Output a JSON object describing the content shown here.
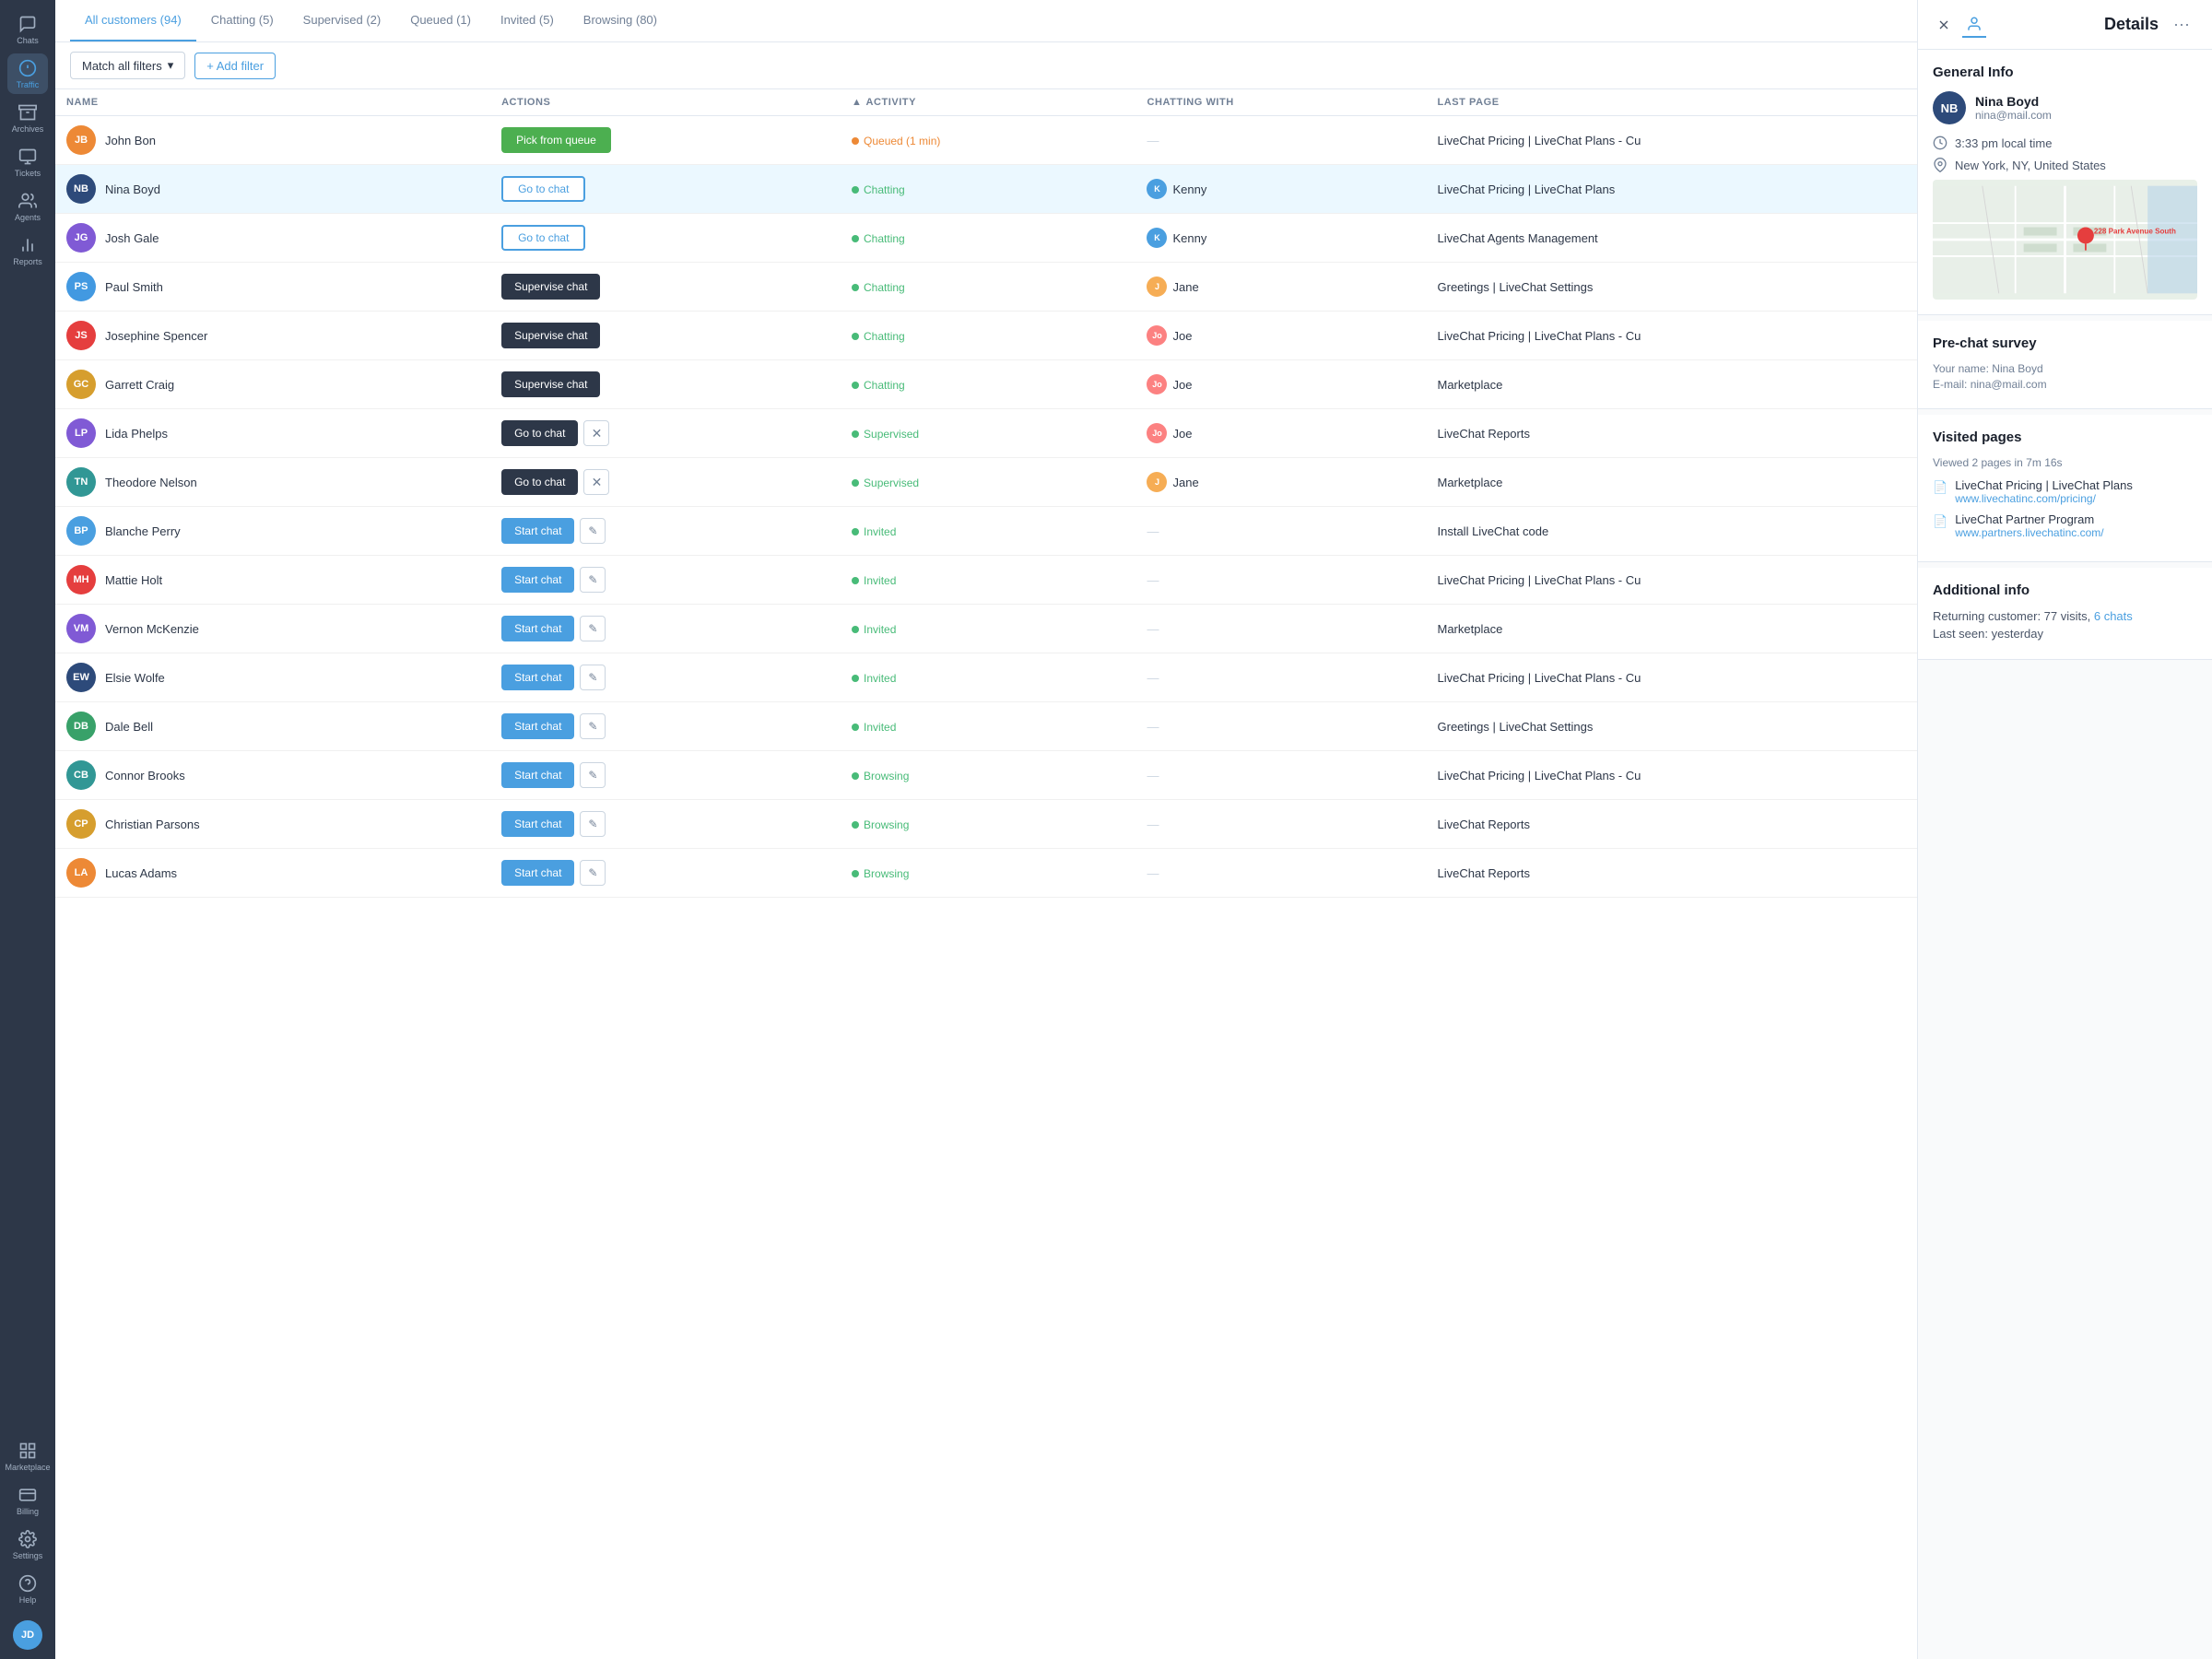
{
  "sidebar": {
    "items": [
      {
        "id": "chat",
        "label": "Chats",
        "icon": "chat"
      },
      {
        "id": "traffic",
        "label": "Traffic",
        "icon": "traffic",
        "active": true
      },
      {
        "id": "archives",
        "label": "Archives",
        "icon": "archives"
      },
      {
        "id": "tickets",
        "label": "Tickets",
        "icon": "tickets"
      },
      {
        "id": "agents",
        "label": "Agents",
        "icon": "agents"
      },
      {
        "id": "reports",
        "label": "Reports",
        "icon": "reports"
      },
      {
        "id": "marketplace",
        "label": "Marketplace",
        "icon": "marketplace"
      },
      {
        "id": "billing",
        "label": "Billing",
        "icon": "billing"
      },
      {
        "id": "settings",
        "label": "Settings",
        "icon": "settings"
      },
      {
        "id": "help",
        "label": "Help",
        "icon": "help"
      }
    ],
    "user_initials": "JD"
  },
  "tabs": [
    {
      "id": "all",
      "label": "All customers (94)",
      "active": true
    },
    {
      "id": "chatting",
      "label": "Chatting (5)",
      "active": false
    },
    {
      "id": "supervised",
      "label": "Supervised (2)",
      "active": false
    },
    {
      "id": "queued",
      "label": "Queued (1)",
      "active": false
    },
    {
      "id": "invited",
      "label": "Invited (5)",
      "active": false
    },
    {
      "id": "browsing",
      "label": "Browsing (80)",
      "active": false
    }
  ],
  "filter": {
    "label": "Match all filters",
    "add_label": "+ Add filter"
  },
  "table": {
    "columns": [
      {
        "id": "name",
        "label": "NAME"
      },
      {
        "id": "actions",
        "label": "ACTIONS"
      },
      {
        "id": "activity",
        "label": "ACTIVITY"
      },
      {
        "id": "chatting_with",
        "label": "CHATTING WITH"
      },
      {
        "id": "last_page",
        "label": "LAST PAGE"
      }
    ],
    "rows": [
      {
        "id": 1,
        "initials": "JB",
        "name": "John Bon",
        "avatar_color": "#ed8936",
        "action_type": "pick_queue",
        "action_label": "Pick from queue",
        "status": "Queued (1 min)",
        "status_type": "queued",
        "agent": null,
        "agent_initials": "",
        "agent_color": "",
        "last_page": "LiveChat Pricing | LiveChat Plans - Cu"
      },
      {
        "id": 2,
        "initials": "NB",
        "name": "Nina Boyd",
        "avatar_color": "#2d4a7a",
        "action_type": "go_chat",
        "action_label": "Go to chat",
        "status": "Chatting",
        "status_type": "chatting",
        "agent": "Kenny",
        "agent_initials": "K",
        "agent_color": "#4a9fe0",
        "last_page": "LiveChat Pricing | LiveChat Plans",
        "selected": true
      },
      {
        "id": 3,
        "initials": "JG",
        "name": "Josh Gale",
        "avatar_color": "#805ad5",
        "action_type": "go_chat",
        "action_label": "Go to chat",
        "status": "Chatting",
        "status_type": "chatting",
        "agent": "Kenny",
        "agent_initials": "K",
        "agent_color": "#4a9fe0",
        "last_page": "LiveChat Agents Management"
      },
      {
        "id": 4,
        "initials": "PS",
        "name": "Paul Smith",
        "avatar_color": "#4299e1",
        "action_type": "supervise",
        "action_label": "Supervise chat",
        "status": "Chatting",
        "status_type": "chatting",
        "agent": "Jane",
        "agent_initials": "J",
        "agent_color": "#f6ad55",
        "last_page": "Greetings | LiveChat Settings"
      },
      {
        "id": 5,
        "initials": "JS",
        "name": "Josephine Spencer",
        "avatar_color": "#e53e3e",
        "action_type": "supervise",
        "action_label": "Supervise chat",
        "status": "Chatting",
        "status_type": "chatting",
        "agent": "Joe",
        "agent_initials": "Jo",
        "agent_color": "#fc8181",
        "last_page": "LiveChat Pricing | LiveChat Plans - Cu"
      },
      {
        "id": 6,
        "initials": "GC",
        "name": "Garrett Craig",
        "avatar_color": "#d69e2e",
        "action_type": "supervise",
        "action_label": "Supervise chat",
        "status": "Chatting",
        "status_type": "chatting",
        "agent": "Joe",
        "agent_initials": "Jo",
        "agent_color": "#fc8181",
        "last_page": "Marketplace"
      },
      {
        "id": 7,
        "initials": "LP",
        "name": "Lida Phelps",
        "avatar_color": "#805ad5",
        "action_type": "go_dark_x",
        "action_label": "Go to chat",
        "status": "Supervised",
        "status_type": "supervised",
        "agent": "Joe",
        "agent_initials": "Jo",
        "agent_color": "#fc8181",
        "last_page": "LiveChat Reports"
      },
      {
        "id": 8,
        "initials": "TN",
        "name": "Theodore Nelson",
        "avatar_color": "#319795",
        "action_type": "go_dark_x",
        "action_label": "Go to chat",
        "status": "Supervised",
        "status_type": "supervised",
        "agent": "Jane",
        "agent_initials": "J",
        "agent_color": "#f6ad55",
        "last_page": "Marketplace"
      },
      {
        "id": 9,
        "initials": "BP",
        "name": "Blanche Perry",
        "avatar_color": "#4a9fe0",
        "action_type": "start_edit",
        "action_label": "Start chat",
        "status": "Invited",
        "status_type": "invited",
        "agent": null,
        "last_page": "Install LiveChat code"
      },
      {
        "id": 10,
        "initials": "MH",
        "name": "Mattie Holt",
        "avatar_color": "#e53e3e",
        "action_type": "start_edit",
        "action_label": "Start chat",
        "status": "Invited",
        "status_type": "invited",
        "agent": null,
        "last_page": "LiveChat Pricing | LiveChat Plans - Cu"
      },
      {
        "id": 11,
        "initials": "VM",
        "name": "Vernon McKenzie",
        "avatar_color": "#805ad5",
        "action_type": "start_edit",
        "action_label": "Start chat",
        "status": "Invited",
        "status_type": "invited",
        "agent": null,
        "last_page": "Marketplace"
      },
      {
        "id": 12,
        "initials": "EW",
        "name": "Elsie Wolfe",
        "avatar_color": "#2d4a7a",
        "action_type": "start_edit",
        "action_label": "Start chat",
        "status": "Invited",
        "status_type": "invited",
        "agent": null,
        "last_page": "LiveChat Pricing | LiveChat Plans - Cu"
      },
      {
        "id": 13,
        "initials": "DB",
        "name": "Dale Bell",
        "avatar_color": "#38a169",
        "action_type": "start_edit",
        "action_label": "Start chat",
        "status": "Invited",
        "status_type": "invited",
        "agent": null,
        "last_page": "Greetings | LiveChat Settings"
      },
      {
        "id": 14,
        "initials": "CB",
        "name": "Connor Brooks",
        "avatar_color": "#319795",
        "action_type": "start_edit",
        "action_label": "Start chat",
        "status": "Browsing",
        "status_type": "browsing",
        "agent": null,
        "last_page": "LiveChat Pricing | LiveChat Plans - Cu"
      },
      {
        "id": 15,
        "initials": "CP",
        "name": "Christian Parsons",
        "avatar_color": "#d69e2e",
        "action_type": "start_edit",
        "action_label": "Start chat",
        "status": "Browsing",
        "status_type": "browsing",
        "agent": null,
        "last_page": "LiveChat Reports"
      },
      {
        "id": 16,
        "initials": "LA",
        "name": "Lucas Adams",
        "avatar_color": "#ed8936",
        "action_type": "start_edit",
        "action_label": "Start chat",
        "status": "Browsing",
        "status_type": "browsing",
        "agent": null,
        "last_page": "LiveChat Reports"
      }
    ]
  },
  "details_panel": {
    "title": "Details",
    "close_icon": "×",
    "general_info": {
      "section_title": "General Info",
      "name": "Nina Boyd",
      "initials": "NB",
      "avatar_color": "#2d4a7a",
      "email": "nina@mail.com",
      "local_time": "3:33 pm local time",
      "location": "New York, NY, United States",
      "map_address": "228 Park Avenue South"
    },
    "pre_chat_survey": {
      "section_title": "Pre-chat survey",
      "name_label": "Your name:",
      "name_value": "Nina Boyd",
      "email_label": "E-mail:",
      "email_value": "nina@mail.com"
    },
    "visited_pages": {
      "section_title": "Visited pages",
      "summary": "Viewed 2 pages in 7m 16s",
      "pages": [
        {
          "title": "LiveChat Pricing | LiveChat Plans",
          "url": "www.livechatinc.com/pricing/"
        },
        {
          "title": "LiveChat Partner Program",
          "url": "www.partners.livechatinc.com/"
        }
      ]
    },
    "additional_info": {
      "section_title": "Additional info",
      "returning_label": "Returning customer: 77 visits,",
      "chats_link": "6 chats",
      "last_seen_label": "Last seen:",
      "last_seen_value": "yesterday"
    }
  }
}
